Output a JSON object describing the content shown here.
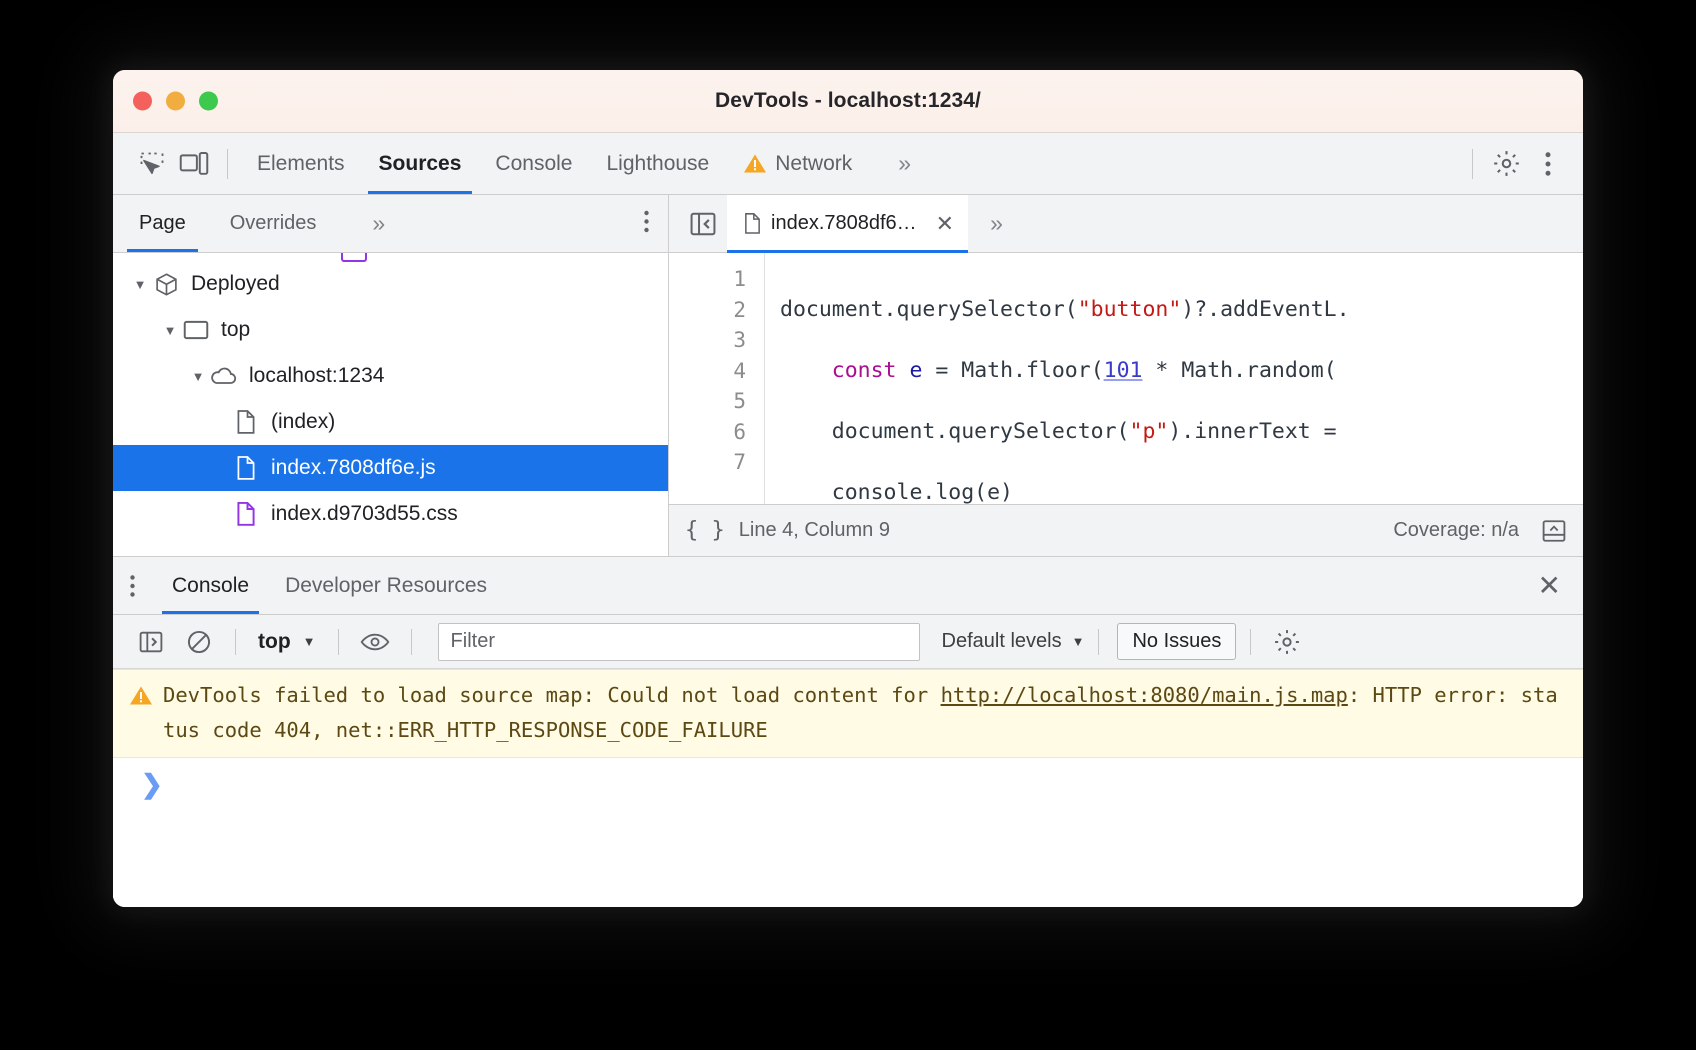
{
  "window": {
    "title": "DevTools - localhost:1234/",
    "traffic_lights": [
      "close",
      "minimize",
      "zoom"
    ]
  },
  "main_toolbar": {
    "icons": [
      {
        "name": "inspect-element-icon"
      },
      {
        "name": "device-toolbar-icon"
      }
    ],
    "tabs": [
      {
        "label": "Elements",
        "active": false,
        "warning": false
      },
      {
        "label": "Sources",
        "active": true,
        "warning": false
      },
      {
        "label": "Console",
        "active": false,
        "warning": false
      },
      {
        "label": "Lighthouse",
        "active": false,
        "warning": false
      },
      {
        "label": "Network",
        "active": false,
        "warning": true
      }
    ],
    "more_tabs": "»",
    "settings_icon": "gear-icon",
    "menu_icon": "kebab-menu-icon"
  },
  "navigator": {
    "tabs": [
      {
        "label": "Page",
        "active": true
      },
      {
        "label": "Overrides",
        "active": false
      }
    ],
    "more_tabs": "»",
    "menu_icon": "kebab-menu-icon",
    "tree": [
      {
        "label": "Deployed",
        "icon": "cube-icon",
        "twisty": "▼",
        "indent": 0,
        "selected": false
      },
      {
        "label": "top",
        "icon": "frame-icon",
        "twisty": "▼",
        "indent": 1,
        "selected": false
      },
      {
        "label": "localhost:1234",
        "icon": "cloud-icon",
        "twisty": "▼",
        "indent": 2,
        "selected": false
      },
      {
        "label": "(index)",
        "icon": "document-icon",
        "twisty": "",
        "indent": 3,
        "selected": false
      },
      {
        "label": "index.7808df6e.js",
        "icon": "document-icon",
        "twisty": "",
        "indent": 3,
        "selected": true
      },
      {
        "label": "index.d9703d55.css",
        "icon": "stylesheet-icon",
        "twisty": "",
        "indent": 3,
        "selected": false
      }
    ]
  },
  "editor": {
    "sidebar_toggle_icon": "show-navigator-icon",
    "tab": {
      "label": "index.7808df6…",
      "file_icon": "document-icon",
      "close_icon": "close-icon"
    },
    "more_tabs": "»",
    "line_numbers": [
      "1",
      "2",
      "3",
      "4",
      "5",
      "6",
      "7"
    ],
    "code_lines": [
      "document.querySelector(\"button\")?.addEventL…",
      "    const e = Math.floor(101 * Math.random(",
      "    document.querySelector(\"p\").innerText =",
      "    console.log(e)",
      "}",
      "));",
      ""
    ],
    "status": {
      "format_icon": "pretty-print-icon",
      "format_glyph": "{ }",
      "cursor": "Line 4, Column 9",
      "coverage": "Coverage: n/a",
      "drawer_toggle_icon": "show-drawer-icon"
    }
  },
  "drawer": {
    "menu_icon": "kebab-menu-icon",
    "tabs": [
      {
        "label": "Console",
        "active": true
      },
      {
        "label": "Developer Resources",
        "active": false
      }
    ],
    "close_icon": "close-icon",
    "toolbar": {
      "sidebar_icon": "console-sidebar-icon",
      "clear_icon": "clear-console-icon",
      "context_value": "top",
      "context_caret": "▼",
      "eye_icon": "live-expression-icon",
      "filter_placeholder": "Filter",
      "filter_value": "",
      "levels_label": "Default levels",
      "levels_caret": "▼",
      "issues_label": "No Issues",
      "settings_icon": "gear-icon"
    },
    "messages": [
      {
        "type": "warning",
        "icon": "warning-triangle-icon",
        "parts": [
          {
            "text": "DevTools failed to load source map: Could not load content for ",
            "link": false
          },
          {
            "text": "http://localhost:8080/main.js.map",
            "link": true
          },
          {
            "text": ": HTTP error: status code 404, net::ERR_HTTP_RESPONSE_CODE_FAILURE",
            "link": false
          }
        ],
        "full_text": "DevTools failed to load source map: Could not load content for http://localhost:8080/main.js.map: HTTP error: status code 404, net::ERR_HTTP_RESPONSE_CODE_FAILURE"
      }
    ],
    "prompt_caret": "❯"
  },
  "colors": {
    "accent": "#1a73e8",
    "selection": "#1a73e8",
    "warning_bg": "#fffbe5",
    "warning_text": "#5c4813",
    "warning_icon": "#f5a623",
    "toolbar_bg": "#f1f3f4",
    "titlebar_bg": "#fdf3ee",
    "string_token": "#c41a16",
    "keyword_token": "#aa0d91",
    "number_token": "#3b3bc9"
  }
}
